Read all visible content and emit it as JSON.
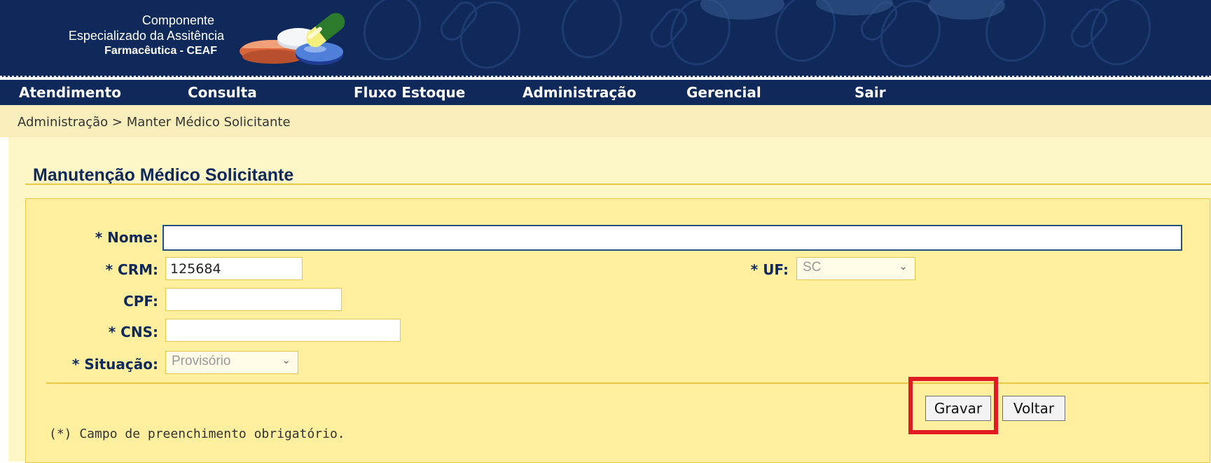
{
  "header": {
    "logo_line1": "Componente",
    "logo_line2": "Especializado da Assitência",
    "logo_line3": "Farmacêutica - CEAF",
    "logo_graphic": "pills-logo"
  },
  "menu": [
    {
      "label": "Atendimento"
    },
    {
      "label": "Consulta"
    },
    {
      "label": "Fluxo Estoque"
    },
    {
      "label": "Administração"
    },
    {
      "label": "Gerencial"
    },
    {
      "label": "Sair"
    }
  ],
  "breadcrumb": "Administração > Manter Médico Solicitante",
  "page_title": "Manutenção Médico Solicitante",
  "form": {
    "nome": {
      "label": "* Nome:",
      "value": ""
    },
    "crm": {
      "label": "* CRM:",
      "value": "125684"
    },
    "uf": {
      "label": "* UF:",
      "value": "SC"
    },
    "cpf": {
      "label": "CPF:",
      "value": ""
    },
    "cns": {
      "label": "* CNS:",
      "value": ""
    },
    "situacao": {
      "label": "* Situação:",
      "value": "Provisório"
    }
  },
  "buttons": {
    "gravar": "Gravar",
    "voltar": "Voltar"
  },
  "footnote": "(*) Campo de preenchimento obrigatório.",
  "colors": {
    "header_navy": "#0f2a5a",
    "content_yellow": "#ffef9e",
    "highlight_red": "#e01b22"
  },
  "icons": {
    "select_arrow": "chevron-down-icon"
  }
}
